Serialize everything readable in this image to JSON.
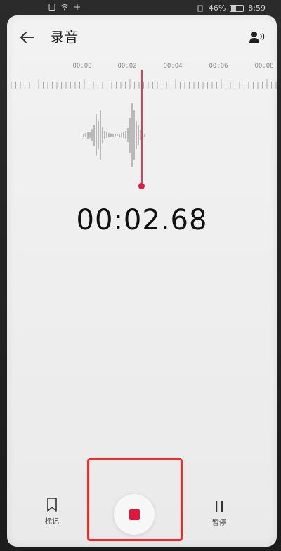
{
  "status_bar": {
    "battery_percent": "46%",
    "time": "8:59"
  },
  "app_bar": {
    "title": "录音",
    "back_icon": "arrow-left-icon",
    "voice_icon": "voice-speaker-icon"
  },
  "timeline": {
    "ticks": [
      "00:00",
      "00:02",
      "00:04",
      "00:06",
      "00:08"
    ]
  },
  "recorder": {
    "elapsed": "00:02.68"
  },
  "controls": {
    "mark_label": "标记",
    "pause_label": "暂停",
    "mark_icon": "bookmark-icon",
    "pause_icon": "pause-icon",
    "stop_icon": "stop-icon"
  },
  "colors": {
    "accent": "#e2153b",
    "playhead": "#e23b5a",
    "highlight": "#f32a2a"
  }
}
